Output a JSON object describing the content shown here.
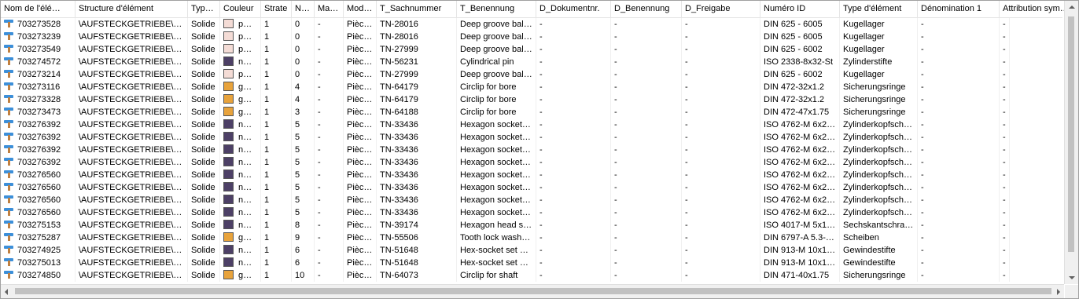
{
  "columns": [
    "Nom de l'élé…",
    "Structure d'élément",
    "Type…",
    "Couleur",
    "Strate",
    "N…",
    "Mat…",
    "Mod…",
    "T_Sachnummer",
    "T_Benennung",
    "D_Dokumentnr.",
    "D_Benennung",
    "D_Freigabe",
    "Numéro ID",
    "Type d'élément",
    "Dénomination 1",
    "Attribution sym…"
  ],
  "colors": {
    "pink": "#f4dcd6",
    "purple": "#4d4066",
    "orange": "#e8a33c"
  },
  "rows": [
    {
      "name": "703273528",
      "structure": "\\AUFSTECKGETRIEBE\\RIT…",
      "type": "Solide",
      "color": "pink",
      "color_label": "p…",
      "strate": "1",
      "n": "0",
      "mat": "-",
      "mod": "Pièce …",
      "sach": "TN-28016",
      "ben": "Deep groove bal…",
      "dnr": "-",
      "dben": "-",
      "dfrei": "-",
      "numid": "DIN 625 - 6005",
      "typel": "Kugellager",
      "denom": "-",
      "attr": "-"
    },
    {
      "name": "703273239",
      "structure": "\\AUFSTECKGETRIEBE\\RIT…",
      "type": "Solide",
      "color": "pink",
      "color_label": "p…",
      "strate": "1",
      "n": "0",
      "mat": "-",
      "mod": "Pièce …",
      "sach": "TN-28016",
      "ben": "Deep groove bal…",
      "dnr": "-",
      "dben": "-",
      "dfrei": "-",
      "numid": "DIN 625 - 6005",
      "typel": "Kugellager",
      "denom": "-",
      "attr": "-"
    },
    {
      "name": "703273549",
      "structure": "\\AUFSTECKGETRIEBE\\ZA…",
      "type": "Solide",
      "color": "pink",
      "color_label": "p…",
      "strate": "1",
      "n": "0",
      "mat": "-",
      "mod": "Pièce …",
      "sach": "TN-27999",
      "ben": "Deep groove bal…",
      "dnr": "-",
      "dben": "-",
      "dfrei": "-",
      "numid": "DIN 625 - 6002",
      "typel": "Kugellager",
      "denom": "-",
      "attr": "-"
    },
    {
      "name": "703274572",
      "structure": "\\AUFSTECKGETRIEBE\\ZA…",
      "type": "Solide",
      "color": "purple",
      "color_label": "n…",
      "strate": "1",
      "n": "0",
      "mat": "-",
      "mod": "Pièce …",
      "sach": "TN-56231",
      "ben": "Cylindrical pin",
      "dnr": "-",
      "dben": "-",
      "dfrei": "-",
      "numid": "ISO 2338-8x32-St",
      "typel": "Zylinderstifte",
      "denom": "-",
      "attr": "-"
    },
    {
      "name": "703273214",
      "structure": "\\AUFSTECKGETRIEBE\\ZA…",
      "type": "Solide",
      "color": "pink",
      "color_label": "p…",
      "strate": "1",
      "n": "0",
      "mat": "-",
      "mod": "Pièce …",
      "sach": "TN-27999",
      "ben": "Deep groove bal…",
      "dnr": "-",
      "dben": "-",
      "dfrei": "-",
      "numid": "DIN 625 - 6002",
      "typel": "Kugellager",
      "denom": "-",
      "attr": "-"
    },
    {
      "name": "703273116",
      "structure": "\\AUFSTECKGETRIEBE\\E6…",
      "type": "Solide",
      "color": "orange",
      "color_label": "g…",
      "strate": "1",
      "n": "4",
      "mat": "-",
      "mod": "Pièce …",
      "sach": "TN-64179",
      "ben": "Circlip for bore",
      "dnr": "-",
      "dben": "-",
      "dfrei": "-",
      "numid": "DIN 472-32x1.2",
      "typel": "Sicherungsringe",
      "denom": "-",
      "attr": "-"
    },
    {
      "name": "703273328",
      "structure": "\\AUFSTECKGETRIEBE\\E6…",
      "type": "Solide",
      "color": "orange",
      "color_label": "g…",
      "strate": "1",
      "n": "4",
      "mat": "-",
      "mod": "Pièce …",
      "sach": "TN-64179",
      "ben": "Circlip for bore",
      "dnr": "-",
      "dben": "-",
      "dfrei": "-",
      "numid": "DIN 472-32x1.2",
      "typel": "Sicherungsringe",
      "denom": "-",
      "attr": "-"
    },
    {
      "name": "703273473",
      "structure": "\\AUFSTECKGETRIEBE\\E6…",
      "type": "Solide",
      "color": "orange",
      "color_label": "g…",
      "strate": "1",
      "n": "3",
      "mat": "-",
      "mod": "Pièce …",
      "sach": "TN-64188",
      "ben": "Circlip for bore",
      "dnr": "-",
      "dben": "-",
      "dfrei": "-",
      "numid": "DIN 472-47x1.75",
      "typel": "Sicherungsringe",
      "denom": "-",
      "attr": "-"
    },
    {
      "name": "703276392",
      "structure": "\\AUFSTECKGETRIEBE\\E6…",
      "type": "Solide",
      "color": "purple",
      "color_label": "n…",
      "strate": "1",
      "n": "5",
      "mat": "-",
      "mod": "Pièce …",
      "sach": "TN-33436",
      "ben": "Hexagon socket…",
      "dnr": "-",
      "dben": "-",
      "dfrei": "-",
      "numid": "ISO 4762-M 6x2…",
      "typel": "Zylinderkopfsch…",
      "denom": "-",
      "attr": "-"
    },
    {
      "name": "703276392",
      "structure": "\\AUFSTECKGETRIEBE\\E6…",
      "type": "Solide",
      "color": "purple",
      "color_label": "n…",
      "strate": "1",
      "n": "5",
      "mat": "-",
      "mod": "Pièce …",
      "sach": "TN-33436",
      "ben": "Hexagon socket…",
      "dnr": "-",
      "dben": "-",
      "dfrei": "-",
      "numid": "ISO 4762-M 6x2…",
      "typel": "Zylinderkopfsch…",
      "denom": "-",
      "attr": "-"
    },
    {
      "name": "703276392",
      "structure": "\\AUFSTECKGETRIEBE\\E6…",
      "type": "Solide",
      "color": "purple",
      "color_label": "n…",
      "strate": "1",
      "n": "5",
      "mat": "-",
      "mod": "Pièce …",
      "sach": "TN-33436",
      "ben": "Hexagon socket…",
      "dnr": "-",
      "dben": "-",
      "dfrei": "-",
      "numid": "ISO 4762-M 6x2…",
      "typel": "Zylinderkopfsch…",
      "denom": "-",
      "attr": "-"
    },
    {
      "name": "703276392",
      "structure": "\\AUFSTECKGETRIEBE\\E6…",
      "type": "Solide",
      "color": "purple",
      "color_label": "n…",
      "strate": "1",
      "n": "5",
      "mat": "-",
      "mod": "Pièce …",
      "sach": "TN-33436",
      "ben": "Hexagon socket…",
      "dnr": "-",
      "dben": "-",
      "dfrei": "-",
      "numid": "ISO 4762-M 6x2…",
      "typel": "Zylinderkopfsch…",
      "denom": "-",
      "attr": "-"
    },
    {
      "name": "703276560",
      "structure": "\\AUFSTECKGETRIEBE\\E6…",
      "type": "Solide",
      "color": "purple",
      "color_label": "n…",
      "strate": "1",
      "n": "5",
      "mat": "-",
      "mod": "Pièce …",
      "sach": "TN-33436",
      "ben": "Hexagon socket…",
      "dnr": "-",
      "dben": "-",
      "dfrei": "-",
      "numid": "ISO 4762-M 6x2…",
      "typel": "Zylinderkopfsch…",
      "denom": "-",
      "attr": "-"
    },
    {
      "name": "703276560",
      "structure": "\\AUFSTECKGETRIEBE\\E6…",
      "type": "Solide",
      "color": "purple",
      "color_label": "n…",
      "strate": "1",
      "n": "5",
      "mat": "-",
      "mod": "Pièce …",
      "sach": "TN-33436",
      "ben": "Hexagon socket…",
      "dnr": "-",
      "dben": "-",
      "dfrei": "-",
      "numid": "ISO 4762-M 6x2…",
      "typel": "Zylinderkopfsch…",
      "denom": "-",
      "attr": "-"
    },
    {
      "name": "703276560",
      "structure": "\\AUFSTECKGETRIEBE\\E6…",
      "type": "Solide",
      "color": "purple",
      "color_label": "n…",
      "strate": "1",
      "n": "5",
      "mat": "-",
      "mod": "Pièce …",
      "sach": "TN-33436",
      "ben": "Hexagon socket…",
      "dnr": "-",
      "dben": "-",
      "dfrei": "-",
      "numid": "ISO 4762-M 6x2…",
      "typel": "Zylinderkopfsch…",
      "denom": "-",
      "attr": "-"
    },
    {
      "name": "703276560",
      "structure": "\\AUFSTECKGETRIEBE\\E6…",
      "type": "Solide",
      "color": "purple",
      "color_label": "n…",
      "strate": "1",
      "n": "5",
      "mat": "-",
      "mod": "Pièce …",
      "sach": "TN-33436",
      "ben": "Hexagon socket…",
      "dnr": "-",
      "dben": "-",
      "dfrei": "-",
      "numid": "ISO 4762-M 6x2…",
      "typel": "Zylinderkopfsch…",
      "denom": "-",
      "attr": "-"
    },
    {
      "name": "703275153",
      "structure": "\\AUFSTECKGETRIEBE\\78…",
      "type": "Solide",
      "color": "purple",
      "color_label": "n…",
      "strate": "1",
      "n": "8",
      "mat": "-",
      "mod": "Pièce …",
      "sach": "TN-39174",
      "ben": "Hexagon head s…",
      "dnr": "-",
      "dben": "-",
      "dfrei": "-",
      "numid": "ISO 4017-M 5x1…",
      "typel": "Sechskantschra…",
      "denom": "-",
      "attr": "-"
    },
    {
      "name": "703275287",
      "structure": "\\AUFSTECKGETRIEBE\\78…",
      "type": "Solide",
      "color": "orange",
      "color_label": "g…",
      "strate": "1",
      "n": "9",
      "mat": "-",
      "mod": "Pièce …",
      "sach": "TN-55506",
      "ben": "Tooth lock wash…",
      "dnr": "-",
      "dben": "-",
      "dfrei": "-",
      "numid": "DIN 6797-A 5.3-…",
      "typel": "Scheiben",
      "denom": "-",
      "attr": "-"
    },
    {
      "name": "703274925",
      "structure": "\\AUFSTECKGETRIEBE\\78…",
      "type": "Solide",
      "color": "purple",
      "color_label": "n…",
      "strate": "1",
      "n": "6",
      "mat": "-",
      "mod": "Pièce …",
      "sach": "TN-51648",
      "ben": "Hex-socket set s…",
      "dnr": "-",
      "dben": "-",
      "dfrei": "-",
      "numid": "DIN 913-M 10x1…",
      "typel": "Gewindestifte",
      "denom": "-",
      "attr": "-"
    },
    {
      "name": "703275013",
      "structure": "\\AUFSTECKGETRIEBE\\78…",
      "type": "Solide",
      "color": "purple",
      "color_label": "n…",
      "strate": "1",
      "n": "6",
      "mat": "-",
      "mod": "Pièce …",
      "sach": "TN-51648",
      "ben": "Hex-socket set s…",
      "dnr": "-",
      "dben": "-",
      "dfrei": "-",
      "numid": "DIN 913-M 10x1…",
      "typel": "Gewindestifte",
      "denom": "-",
      "attr": "-"
    },
    {
      "name": "703274850",
      "structure": "\\AUFSTECKGETRIEBE\\78…",
      "type": "Solide",
      "color": "orange",
      "color_label": "g…",
      "strate": "1",
      "n": "10",
      "mat": "-",
      "mod": "Pièce …",
      "sach": "TN-64073",
      "ben": "Circlip for shaft",
      "dnr": "-",
      "dben": "-",
      "dfrei": "-",
      "numid": "DIN 471-40x1.75",
      "typel": "Sicherungsringe",
      "denom": "-",
      "attr": "-"
    }
  ]
}
